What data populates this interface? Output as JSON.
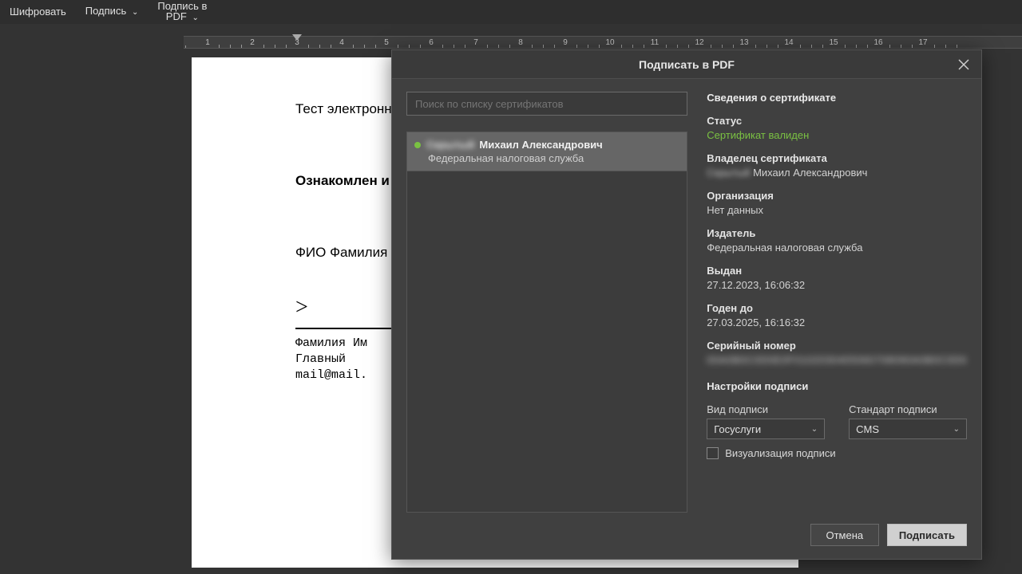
{
  "toolbar": {
    "encrypt": "Шифровать",
    "sign": "Подпись",
    "sign_pdf_line1": "Подпись в",
    "sign_pdf_line2": "PDF"
  },
  "ruler": {
    "start": 1,
    "end": 17,
    "tab_at": 3
  },
  "document": {
    "line1": "Тест электронной подписи",
    "line2": "Ознакомлен и согласен",
    "line3": "ФИО Фамилия Имя Отчество",
    "sig_mark": ">",
    "sig_l1": "Фамилия Им",
    "sig_l2": "Главный",
    "sig_l3": "mail@mail."
  },
  "dialog": {
    "title": "Подписать в PDF",
    "search_placeholder": "Поиск по списку сертификатов",
    "cert": {
      "surname_blurred": "Скрытый",
      "name_rest": "Михаил Александрович",
      "org": "Федеральная налоговая служба"
    },
    "details": {
      "heading": "Сведения о сертификате",
      "status_label": "Статус",
      "status_value": "Сертификат валиден",
      "owner_label": "Владелец сертификата",
      "owner_surname_blurred": "Скрытый",
      "owner_rest": "Михаил Александрович",
      "org_label": "Организация",
      "org_value": "Нет данных",
      "issuer_label": "Издатель",
      "issuer_value": "Федеральная налоговая служба",
      "issued_label": "Выдан",
      "issued_value": "27.12.2023, 16:06:32",
      "valid_to_label": "Годен до",
      "valid_to_value": "27.03.2025, 16:16:32",
      "serial_label": "Серийный номер",
      "serial_value_blurred": "00A0B0C0D0E0F0102030405060708090A0B0C0D0"
    },
    "settings": {
      "heading": "Настройки подписи",
      "kind_label": "Вид подписи",
      "kind_value": "Госуслуги",
      "standard_label": "Стандарт подписи",
      "standard_value": "CMS",
      "viz_label": "Визуализация подписи"
    },
    "buttons": {
      "cancel": "Отмена",
      "sign": "Подписать"
    }
  }
}
